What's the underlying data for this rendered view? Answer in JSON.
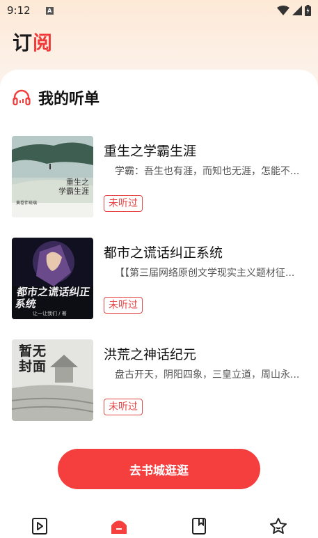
{
  "status_bar": {
    "time": "9:12",
    "notification_badge": "A"
  },
  "header": {
    "title_main": "订",
    "title_accent": "阅"
  },
  "section": {
    "title": "我的听单",
    "icon": "headphones-icon"
  },
  "books": [
    {
      "title": "重生之学霸生涯",
      "description": "学霸：吾生也有涯，而知也无涯，怎能不...",
      "status": "未听过",
      "cover_text": "重生之\n学霸生涯",
      "cover_author": "黄卷伴琉璃"
    },
    {
      "title": "都市之谎话纠正系统",
      "description": "【【第三届网络原创文学现实主义题材征...",
      "status": "未听过",
      "cover_text": "都市之谎话纠正系统",
      "cover_author": "让一让我们 / 著"
    },
    {
      "title": "洪荒之神话纪元",
      "description": "盘古开天，阴阳四象，三皇立道，周山永...",
      "status": "未听过",
      "cover_text": "暂无封面"
    }
  ],
  "cta": {
    "label": "去书城逛逛"
  },
  "bottom_nav": [
    {
      "icon": "play-book-icon",
      "active": false
    },
    {
      "icon": "bookshelf-icon",
      "active": true
    },
    {
      "icon": "bookmark-icon",
      "active": false
    },
    {
      "icon": "star-icon",
      "active": false
    }
  ],
  "colors": {
    "accent": "#f53f3f",
    "text": "#111111",
    "muted": "#555555"
  }
}
